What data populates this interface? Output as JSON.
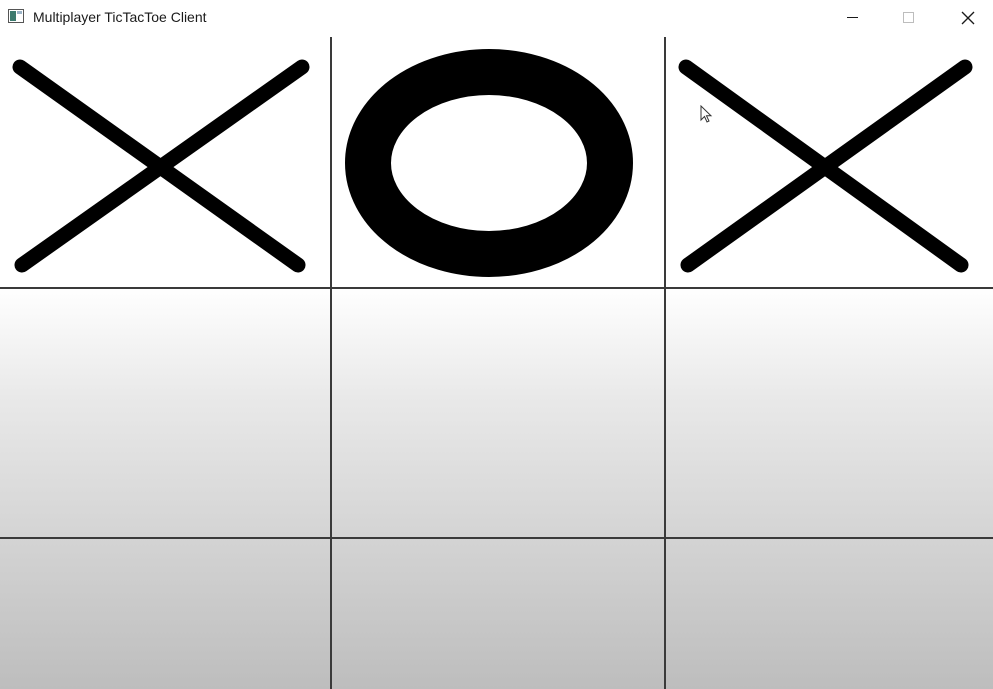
{
  "window": {
    "title": "Multiplayer TicTacToe Client",
    "app_icon": "app-window-icon",
    "controls": {
      "minimize_icon": "minimize-icon",
      "maximize_icon": "maximize-icon",
      "close_icon": "close-icon"
    }
  },
  "game": {
    "board": [
      [
        "X",
        "O",
        "X"
      ],
      [
        "",
        "",
        ""
      ],
      [
        "",
        "",
        ""
      ]
    ],
    "colors": {
      "mark": "#000000",
      "grid": "#3a3a3a",
      "top": "#ffffff",
      "bottom": "#bdbdbd"
    }
  }
}
